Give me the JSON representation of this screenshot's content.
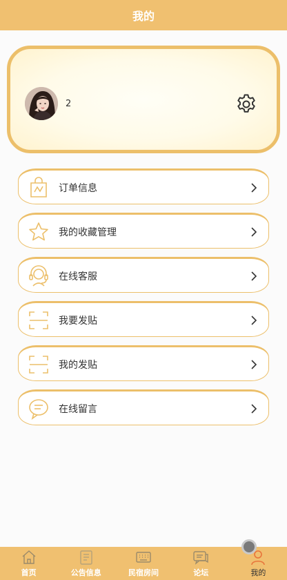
{
  "header": {
    "title": "我的"
  },
  "profile": {
    "name": "2",
    "avatar_icon": "user-avatar-photo",
    "settings_icon": "gear-icon"
  },
  "menu": [
    {
      "label": "订单信息",
      "icon": "shopping-bag-icon"
    },
    {
      "label": "我的收藏管理",
      "icon": "star-icon"
    },
    {
      "label": "在线客服",
      "icon": "headset-icon"
    },
    {
      "label": "我要发贴",
      "icon": "scan-frame-icon"
    },
    {
      "label": "我的发贴",
      "icon": "scan-frame-icon"
    },
    {
      "label": "在线留言",
      "icon": "chat-bubble-icon"
    }
  ],
  "tabbar": [
    {
      "label": "首页",
      "icon": "home-icon"
    },
    {
      "label": "公告信息",
      "icon": "notice-icon"
    },
    {
      "label": "民宿房间",
      "icon": "keyboard-icon"
    },
    {
      "label": "论坛",
      "icon": "forum-icon"
    },
    {
      "label": "我的",
      "icon": "person-icon",
      "active": true
    }
  ],
  "colors": {
    "accent": "#f0c070",
    "border": "#ecbf6a",
    "active_tab": "#e8743b"
  }
}
